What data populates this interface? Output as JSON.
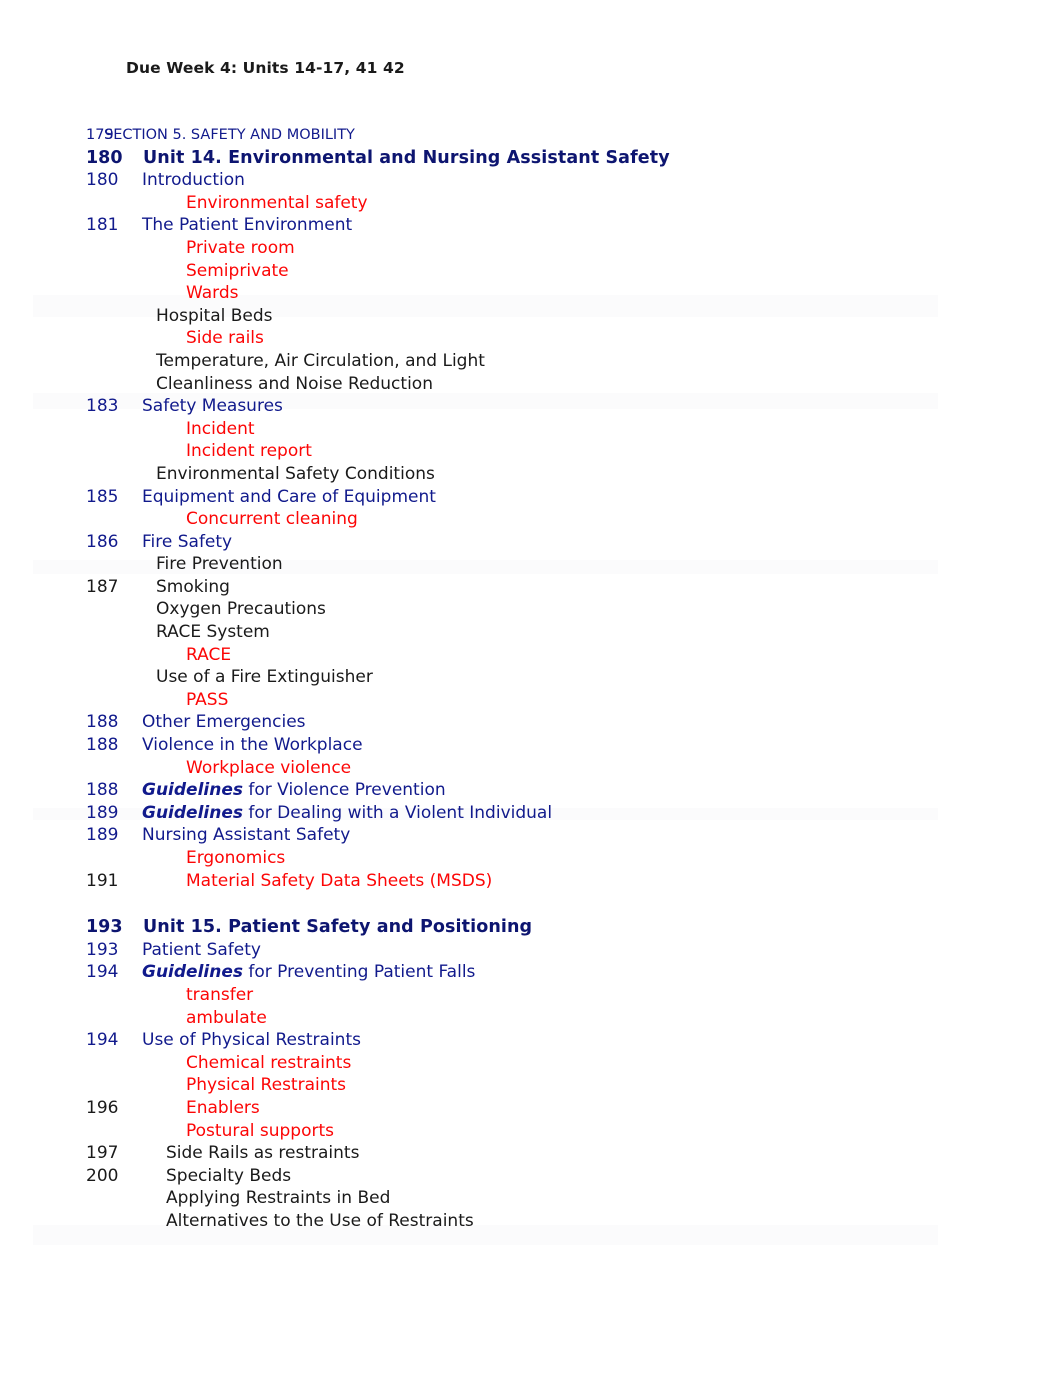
{
  "header": {
    "text": "Due Week 4: Units 14-17, 41 42"
  },
  "colors": {
    "navy": "#111a8c",
    "red": "#fc0606",
    "black": "#1a1a1a",
    "background": "#ffffff"
  },
  "toc": {
    "rows": [
      {
        "num": "179",
        "text": "SECTION 5. SAFETY AND MOBILITY",
        "style": "section"
      },
      {
        "num": "180",
        "text": "Unit 14. Environmental and Nursing Assistant Safety",
        "style": "unit"
      },
      {
        "num": "180",
        "text": "Introduction",
        "style": "blue"
      },
      {
        "num": "",
        "text": "Environmental safety",
        "style": "red"
      },
      {
        "num": "181",
        "text": "The Patient Environment",
        "style": "blue"
      },
      {
        "num": "",
        "text": "Private room",
        "style": "red"
      },
      {
        "num": "",
        "text": "Semiprivate",
        "style": "red"
      },
      {
        "num": "",
        "text": "Wards",
        "style": "red"
      },
      {
        "num": "",
        "text": "Hospital Beds",
        "style": "black"
      },
      {
        "num": "",
        "text": "Side rails",
        "style": "red"
      },
      {
        "num": "",
        "text": "Temperature, Air Circulation, and Light",
        "style": "black"
      },
      {
        "num": "",
        "text": "Cleanliness and Noise Reduction",
        "style": "black"
      },
      {
        "num": "183",
        "text": "Safety Measures",
        "style": "blue"
      },
      {
        "num": "",
        "text": "Incident",
        "style": "red"
      },
      {
        "num": "",
        "text": "Incident report",
        "style": "red"
      },
      {
        "num": "",
        "text": "Environmental Safety Conditions",
        "style": "black"
      },
      {
        "num": "185",
        "text": "Equipment and Care of Equipment",
        "style": "blue"
      },
      {
        "num": "",
        "text": "Concurrent cleaning",
        "style": "red"
      },
      {
        "num": "186",
        "text": "Fire Safety",
        "style": "blue"
      },
      {
        "num": "",
        "text": "Fire Prevention",
        "style": "black"
      },
      {
        "num": "187",
        "text": "Smoking",
        "style": "black-num"
      },
      {
        "num": "",
        "text": "Oxygen Precautions",
        "style": "black"
      },
      {
        "num": "",
        "text": "RACE System",
        "style": "black"
      },
      {
        "num": "",
        "text": "RACE",
        "style": "red"
      },
      {
        "num": "",
        "text": "Use of a Fire Extinguisher",
        "style": "black"
      },
      {
        "num": "",
        "text": "PASS",
        "style": "red"
      },
      {
        "num": "188",
        "text": "Other Emergencies",
        "style": "blue"
      },
      {
        "num": "188",
        "text": "Violence in the Workplace",
        "style": "blue"
      },
      {
        "num": "",
        "text": "Workplace violence",
        "style": "red"
      },
      {
        "num": "188",
        "text": "Guidelines",
        "text2": " for Violence Prevention",
        "style": "guidelines"
      },
      {
        "num": "189",
        "text": "Guidelines",
        "text2": " for Dealing with a Violent Individual",
        "style": "guidelines"
      },
      {
        "num": "189",
        "text": "Nursing Assistant Safety",
        "style": "blue"
      },
      {
        "num": "",
        "text": "Ergonomics",
        "style": "red"
      },
      {
        "num": "191",
        "text": "Material Safety Data Sheets (MSDS)",
        "style": "red-num"
      },
      {
        "num": "",
        "text": "",
        "style": "gap"
      },
      {
        "num": "193",
        "text": "Unit 15. Patient Safety and Positioning",
        "style": "unit"
      },
      {
        "num": "193",
        "text": "Patient Safety",
        "style": "blue"
      },
      {
        "num": "194",
        "text": "Guidelines",
        "text2": " for Preventing Patient Falls",
        "style": "guidelines"
      },
      {
        "num": "",
        "text": "transfer",
        "style": "red"
      },
      {
        "num": "",
        "text": "ambulate",
        "style": "red"
      },
      {
        "num": "194",
        "text": "Use of Physical Restraints",
        "style": "blue"
      },
      {
        "num": "",
        "text": "Chemical restraints",
        "style": "red"
      },
      {
        "num": "",
        "text": "Physical Restraints",
        "style": "red"
      },
      {
        "num": "196",
        "text": "Enablers",
        "style": "red-num"
      },
      {
        "num": "",
        "text": "Postural supports",
        "style": "red"
      },
      {
        "num": "197",
        "text": "Side Rails as restraints",
        "style": "black-num2"
      },
      {
        "num": "200",
        "text": "Specialty Beds",
        "style": "black-num2"
      },
      {
        "num": "",
        "text": "Applying Restraints in Bed",
        "style": "black2"
      },
      {
        "num": "",
        "text": "Alternatives to the Use of Restraints",
        "style": "black2"
      }
    ]
  }
}
